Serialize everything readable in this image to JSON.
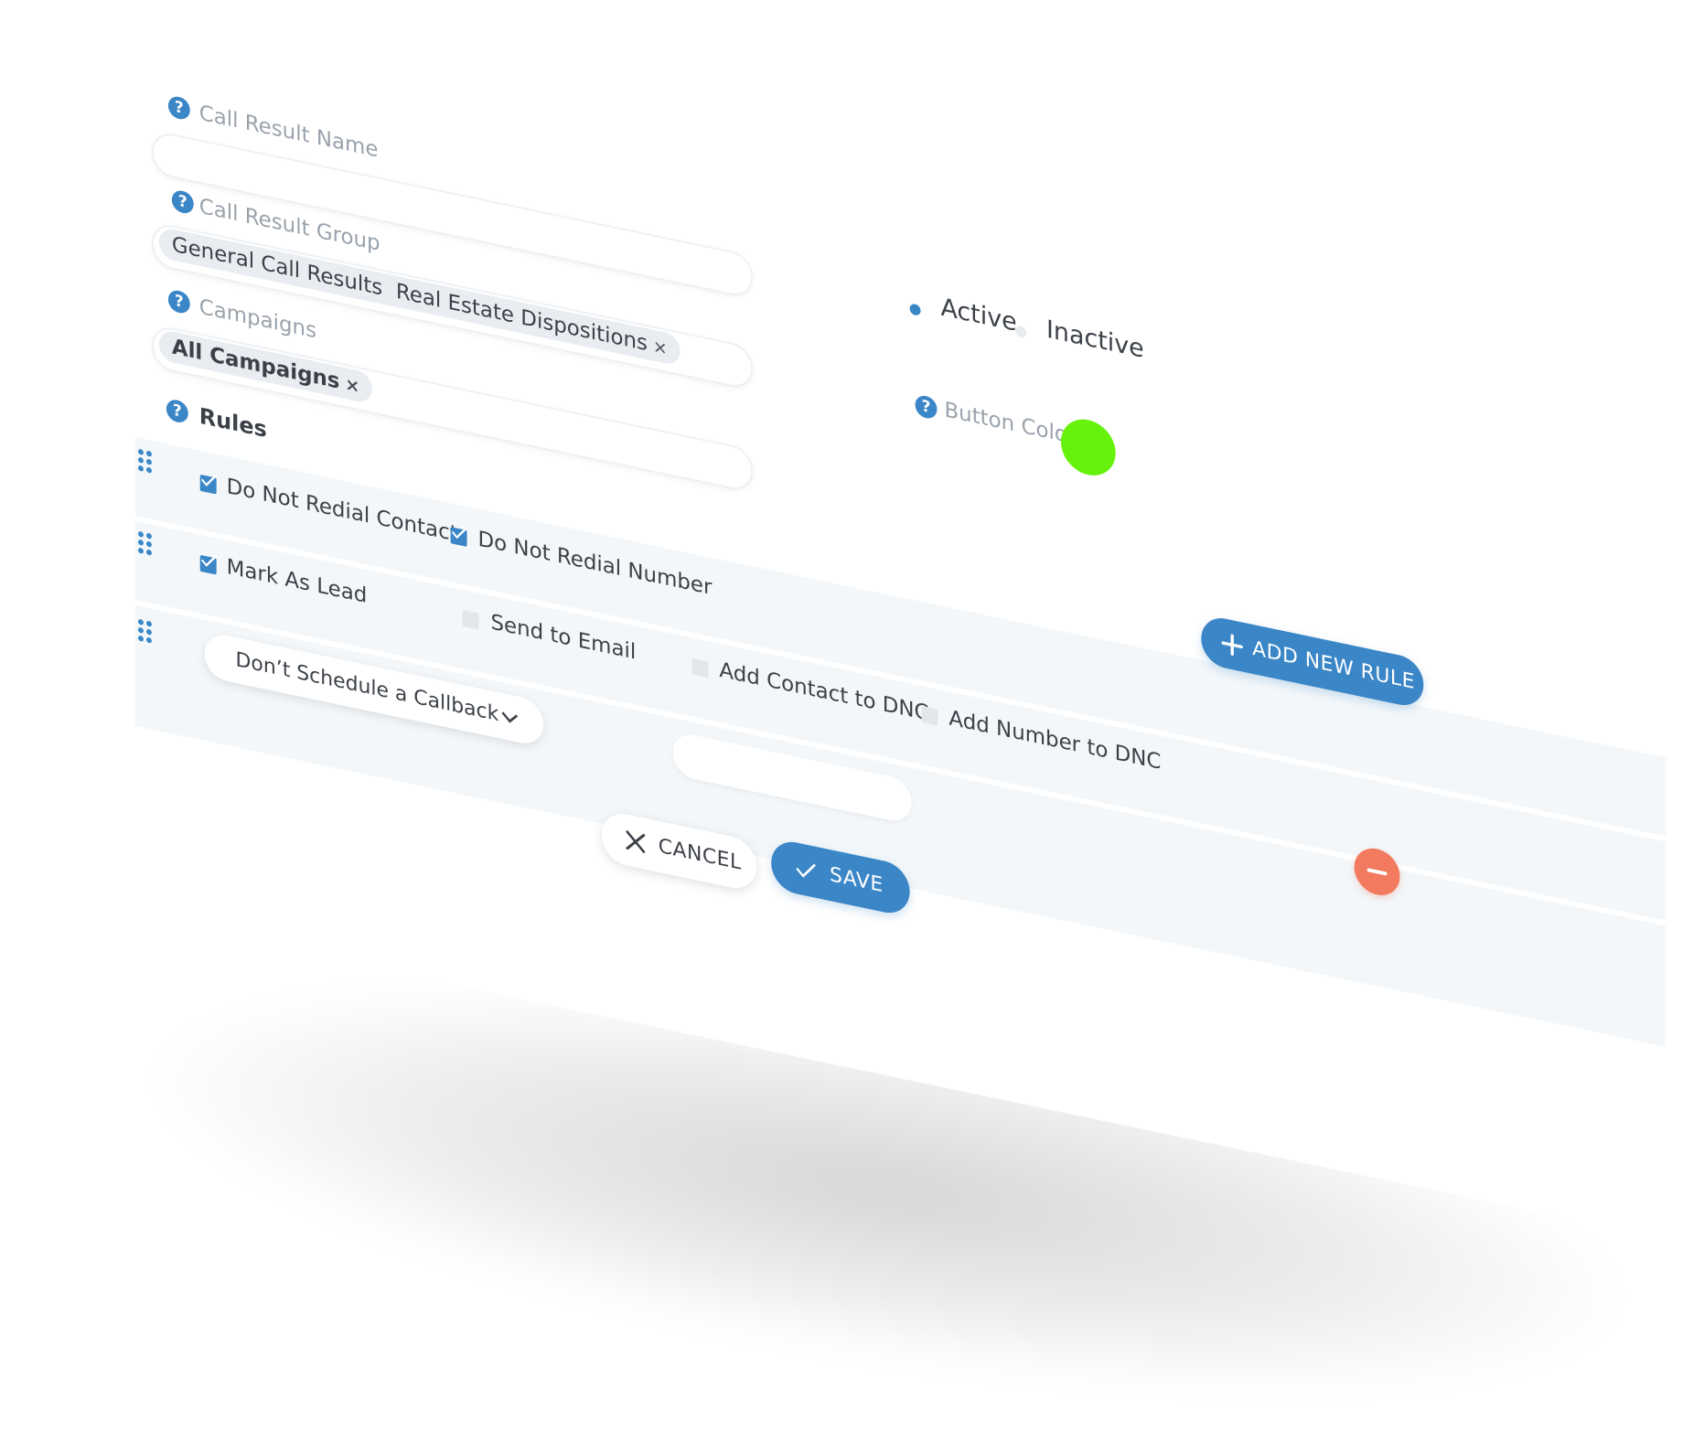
{
  "form": {
    "call_result_name": {
      "label": "Call Result Name",
      "value": ""
    },
    "call_result_group": {
      "label": "Call Result Group",
      "chips": [
        "General Call Results",
        "Real Estate Dispositions"
      ]
    },
    "campaigns": {
      "label": "Campaigns",
      "chips": [
        "All Campaigns"
      ]
    },
    "status": {
      "options": [
        "Active",
        "Inactive"
      ],
      "selected": "Active"
    },
    "button_color": {
      "label": "Button Color",
      "value": "#66f20a"
    },
    "chip_remove_glyph": "×"
  },
  "rules": {
    "heading": "Rules",
    "row1": {
      "do_not_redial_contact": {
        "label": "Do Not Redial Contact",
        "checked": true
      },
      "do_not_redial_number": {
        "label": "Do Not Redial Number",
        "checked": true
      }
    },
    "row2": {
      "mark_as_lead": {
        "label": "Mark As Lead",
        "checked": true
      },
      "send_to_email": {
        "label": "Send to Email",
        "checked": false
      },
      "add_contact_to_dnc": {
        "label": "Add Contact to DNC",
        "checked": false
      },
      "add_number_to_dnc": {
        "label": "Add Number to DNC",
        "checked": false
      }
    },
    "row3": {
      "callback_select": {
        "value": "Don’t Schedule a Callback"
      },
      "email_input": {
        "value": ""
      }
    },
    "add_rule_label": "ADD NEW RULE"
  },
  "actions": {
    "cancel_label": "CANCEL",
    "save_label": "SAVE"
  },
  "colors": {
    "accent": "#3a86c7",
    "remove": "#f27a5e",
    "row_bg": "#f3f7fa"
  },
  "icons": {
    "help": "question-circle-icon",
    "drag": "drag-handle-icon",
    "chevron": "chevron-down-icon",
    "plus": "plus-icon",
    "close": "close-icon",
    "check": "check-icon",
    "minus": "minus-icon"
  }
}
